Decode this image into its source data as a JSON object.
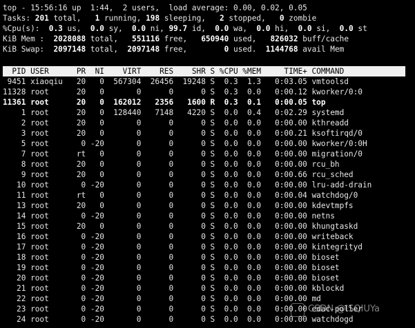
{
  "summary": {
    "l1": "top - 15:56:16 up  1:44,  2 users,  load average: 0.00, 0.02, 0.05",
    "l2": {
      "a": "Tasks: ",
      "total": "201",
      "b": " total,   ",
      "running": "1",
      "c": " running, ",
      "sleeping": "198",
      "d": " sleeping,   ",
      "stopped": "2",
      "e": " stopped,   ",
      "zombie": "0",
      "f": " zombie"
    },
    "l3": {
      "a": "%Cpu(s):  ",
      "us": "0.3",
      "b": " us,  ",
      "sy": "0.0",
      "c": " sy,  ",
      "ni": "0.0",
      "d": " ni, ",
      "id": "99.7",
      "e": " id,  ",
      "wa": "0.0",
      "f": " wa,  ",
      "hi": "0.0",
      "g": " hi,  ",
      "si": "0.0",
      "h": " si,  ",
      "st": "0.0",
      "i": " st"
    },
    "l4": {
      "a": "KiB Mem :  ",
      "total": "2028088",
      "b": " total,   ",
      "free": "551116",
      "c": " free,   ",
      "used": "650940",
      "d": " used,   ",
      "buff": "826032",
      "e": " buff/cache"
    },
    "l5": {
      "a": "KiB Swap:  ",
      "total": "2097148",
      "b": " total,  ",
      "free": "2097148",
      "c": " free,        ",
      "used": "0",
      "d": " used.  ",
      "avail": "1144768",
      "e": " avail Mem"
    }
  },
  "header": "  PID USER      PR  NI    VIRT    RES    SHR S %CPU %MEM     TIME+ COMMAND",
  "processes": [
    " 9451 xiaoqiu   20   0  567304  26456  19248 S  0.3  1.3   0:03.05 vmtoolsd",
    "11328 root      20   0       0      0      0 S  0.3  0.0   0:00.12 kworker/0:0",
    "11361 root      20   0  162012   2356   1600 R  0.3  0.1   0:00.05 top",
    "    1 root      20   0  128440   7148   4220 S  0.0  0.4   0:02.29 systemd",
    "    2 root      20   0       0      0      0 S  0.0  0.0   0:00.00 kthreadd",
    "    3 root      20   0       0      0      0 S  0.0  0.0   0:00.21 ksoftirqd/0",
    "    5 root       0 -20       0      0      0 S  0.0  0.0   0:00.00 kworker/0:0H",
    "    7 root      rt   0       0      0      0 S  0.0  0.0   0:00.00 migration/0",
    "    8 root      20   0       0      0      0 S  0.0  0.0   0:00.00 rcu_bh",
    "    9 root      20   0       0      0      0 S  0.0  0.0   0:00.66 rcu_sched",
    "   10 root       0 -20       0      0      0 S  0.0  0.0   0:00.00 lru-add-drain",
    "   11 root      rt   0       0      0      0 S  0.0  0.0   0:00.04 watchdog/0",
    "   13 root      20   0       0      0      0 S  0.0  0.0   0:00.00 kdevtmpfs",
    "   14 root       0 -20       0      0      0 S  0.0  0.0   0:00.00 netns",
    "   15 root      20   0       0      0      0 S  0.0  0.0   0:00.00 khungtaskd",
    "   16 root       0 -20       0      0      0 S  0.0  0.0   0:00.00 writeback",
    "   17 root       0 -20       0      0      0 S  0.0  0.0   0:00.00 kintegrityd",
    "   18 root       0 -20       0      0      0 S  0.0  0.0   0:00.00 bioset",
    "   19 root       0 -20       0      0      0 S  0.0  0.0   0:00.00 bioset",
    "   20 root       0 -20       0      0      0 S  0.0  0.0   0:00.00 bioset",
    "   21 root       0 -20       0      0      0 S  0.0  0.0   0:00.00 kblockd",
    "   22 root       0 -20       0      0      0 S  0.0  0.0   0:00.00 md",
    "   23 root       0 -20       0      0      0 S  0.0  0.0   0:00.00 edac-poller",
    "   24 root       0 -20       0      0      0 S  0.0  0.0   0:00.00 watchdogd"
  ],
  "highlight_row": 2,
  "watermark": "CSDN @ISQIUYa",
  "colors": {
    "background": "#000000",
    "text": "#e8e8e8",
    "header_bg": "#f0f0f0",
    "header_text": "#000000"
  }
}
